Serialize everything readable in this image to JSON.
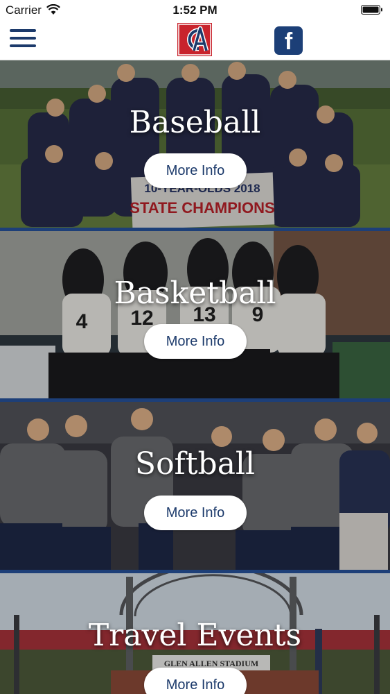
{
  "status_bar": {
    "carrier": "Carrier",
    "time": "1:52 PM"
  },
  "nav": {
    "logo_icon": "glen-allen-logo",
    "menu_icon": "hamburger-menu-icon",
    "social_icon": "facebook-icon",
    "facebook_glyph": "f"
  },
  "tiles": [
    {
      "title": "Baseball",
      "button": "More Info"
    },
    {
      "title": "Basketball",
      "button": "More Info"
    },
    {
      "title": "Softball",
      "button": "More Info"
    },
    {
      "title": "Travel Events",
      "button": "More Info"
    }
  ],
  "photo_text": {
    "banner_line1": "10-YEAR-OLDS 2018",
    "banner_line2": "STATE CHAMPIONS",
    "stadium_sign": "GLEN ALLEN STADIUM",
    "jersey_numbers": [
      "4",
      "12",
      "13",
      "9"
    ]
  },
  "colors": {
    "navy": "#1c3a6b",
    "accent_red": "#c8232c",
    "divider": "#1d3f78"
  }
}
